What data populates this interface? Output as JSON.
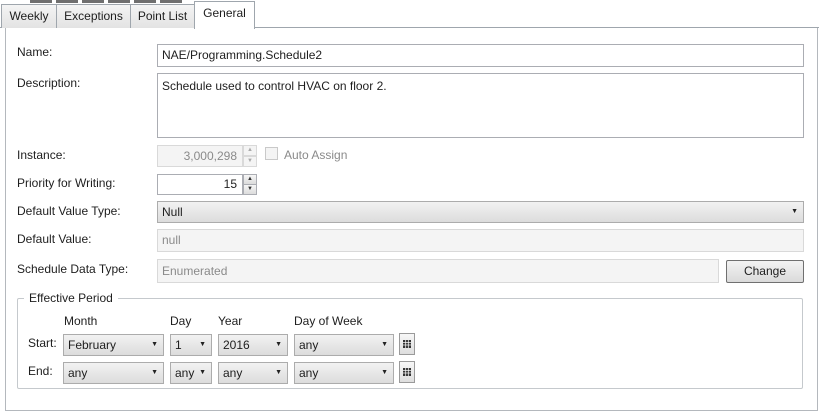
{
  "tabs": [
    {
      "label": "Weekly"
    },
    {
      "label": "Exceptions"
    },
    {
      "label": "Point List"
    },
    {
      "label": "General"
    }
  ],
  "fields": {
    "name": {
      "label": "Name:",
      "value": "NAE/Programming.Schedule2"
    },
    "description": {
      "label": "Description:",
      "value": "Schedule used to control HVAC on floor 2."
    },
    "instance": {
      "label": "Instance:",
      "value": "3,000,298"
    },
    "auto_assign": {
      "label": "Auto Assign",
      "checked": false
    },
    "priority": {
      "label": "Priority for Writing:",
      "value": "15"
    },
    "default_value_type": {
      "label": "Default Value Type:",
      "value": "Null"
    },
    "default_value": {
      "label": "Default Value:",
      "value": "null"
    },
    "schedule_data_type": {
      "label": "Schedule Data Type:",
      "value": "Enumerated"
    },
    "change_button": "Change"
  },
  "effective_period": {
    "title": "Effective Period",
    "headers": {
      "month": "Month",
      "day": "Day",
      "year": "Year",
      "dow": "Day of Week"
    },
    "start": {
      "label": "Start:",
      "month": "February",
      "day": "1",
      "year": "2016",
      "dow": "any"
    },
    "end": {
      "label": "End:",
      "month": "any",
      "day": "any",
      "year": "any",
      "dow": "any"
    }
  },
  "icons": {
    "dropdown": "chevron-down-icon",
    "spin_up": "spin-up-icon",
    "spin_down": "spin-down-icon",
    "calendar": "calendar-icon"
  }
}
